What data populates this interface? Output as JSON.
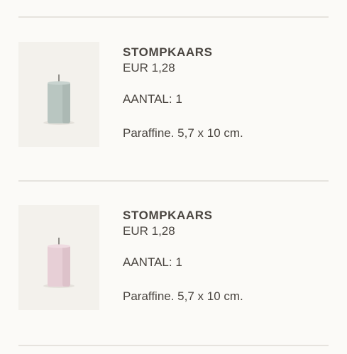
{
  "items": [
    {
      "name": "STOMPKAARS",
      "price": "EUR 1,28",
      "quantity": "AANTAL: 1",
      "description": "Paraffine. 5,7 x 10 cm.",
      "candle_color": "#b9c6c1",
      "candle_shade": "#a6b4ae",
      "image_icon": "candle-sage-icon"
    },
    {
      "name": "STOMPKAARS",
      "price": "EUR 1,28",
      "quantity": "AANTAL: 1",
      "description": "Paraffine. 5,7 x 10 cm.",
      "candle_color": "#e7cfd6",
      "candle_shade": "#d8bcc5",
      "image_icon": "candle-pink-icon"
    }
  ]
}
